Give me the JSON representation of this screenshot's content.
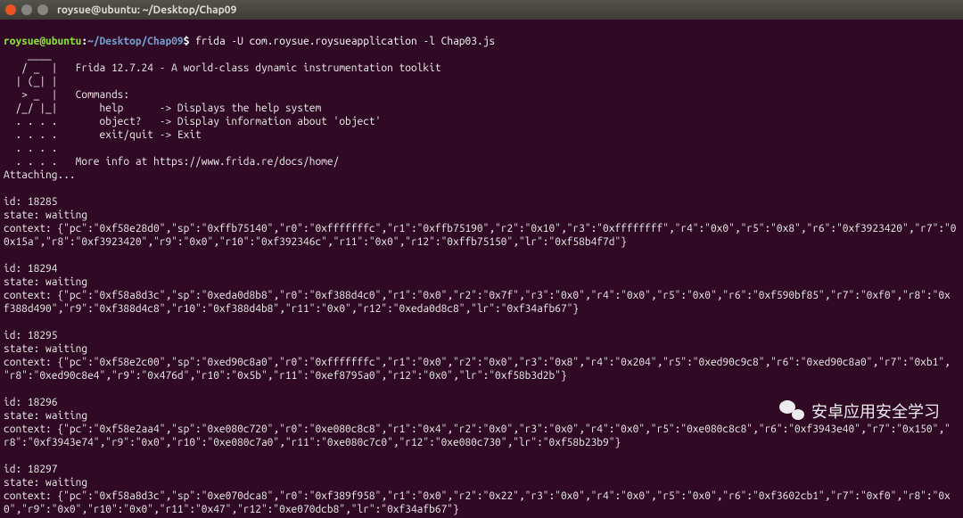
{
  "window": {
    "title": "roysue@ubuntu: ~/Desktop/Chap09"
  },
  "prompt": {
    "userhost": "roysue@ubuntu",
    "sep1": ":",
    "path": "~/Desktop/Chap09",
    "dollar": "$",
    "command": "frida -U com.roysue.roysueapplication -l Chap03.js"
  },
  "frida_banner": {
    "l1": "    ____",
    "l2": "   / _  |   Frida 12.7.24 - A world-class dynamic instrumentation toolkit",
    "l3": "  | (_| |",
    "l4": "   > _  |   Commands:",
    "l5": "  /_/ |_|       help      -> Displays the help system",
    "l6": "  . . . .       object?   -> Display information about 'object'",
    "l7": "  . . . .       exit/quit -> Exit",
    "l8": "  . . . .",
    "l9": "  . . . .   More info at https://www.frida.re/docs/home/",
    "attaching": "Attaching..."
  },
  "threads": [
    {
      "id_line": "id: 18285",
      "state_line": "state: waiting",
      "ctx1": "context: {\"pc\":\"0xf58e28d0\",\"sp\":\"0xffb75140\",\"r0\":\"0xfffffffc\",\"r1\":\"0xffb75190\",\"r2\":\"0x10\",\"r3\":\"0xffffffff\",\"r4\":\"0x0\",\"r5\":\"0x8\",\"r6\":\"0xf3923420\",\"r7\":\"0",
      "ctx2": "0x15a\",\"r8\":\"0xf3923420\",\"r9\":\"0x0\",\"r10\":\"0xf392346c\",\"r11\":\"0x0\",\"r12\":\"0xffb75150\",\"lr\":\"0xf58b4f7d\"}"
    },
    {
      "id_line": "id: 18294",
      "state_line": "state: waiting",
      "ctx1": "context: {\"pc\":\"0xf58a8d3c\",\"sp\":\"0xeda0d8b8\",\"r0\":\"0xf388d4c0\",\"r1\":\"0x0\",\"r2\":\"0x7f\",\"r3\":\"0x0\",\"r4\":\"0x0\",\"r5\":\"0x0\",\"r6\":\"0xf590bf85\",\"r7\":\"0xf0\",\"r8\":\"0x",
      "ctx2": "f388d490\",\"r9\":\"0xf388d4c8\",\"r10\":\"0xf388d4b8\",\"r11\":\"0x0\",\"r12\":\"0xeda0d8c8\",\"lr\":\"0xf34afb67\"}"
    },
    {
      "id_line": "id: 18295",
      "state_line": "state: waiting",
      "ctx1": "context: {\"pc\":\"0xf58e2c00\",\"sp\":\"0xed90c8a0\",\"r0\":\"0xfffffffc\",\"r1\":\"0x0\",\"r2\":\"0x0\",\"r3\":\"0x8\",\"r4\":\"0x204\",\"r5\":\"0xed90c9c8\",\"r6\":\"0xed90c8a0\",\"r7\":\"0xb1\",",
      "ctx2": "\"r8\":\"0xed90c8e4\",\"r9\":\"0x476d\",\"r10\":\"0x5b\",\"r11\":\"0xef8795a0\",\"r12\":\"0x0\",\"lr\":\"0xf58b3d2b\"}"
    },
    {
      "id_line": "id: 18296",
      "state_line": "state: waiting",
      "ctx1": "context: {\"pc\":\"0xf58e2aa4\",\"sp\":\"0xe080c720\",\"r0\":\"0xe080c8c8\",\"r1\":\"0x4\",\"r2\":\"0x0\",\"r3\":\"0x0\",\"r4\":\"0x0\",\"r5\":\"0xe080c8c8\",\"r6\":\"0xf3943e40\",\"r7\":\"0x150\",\"",
      "ctx2": "r8\":\"0xf3943e74\",\"r9\":\"0x0\",\"r10\":\"0xe080c7a0\",\"r11\":\"0xe080c7c0\",\"r12\":\"0xe080c730\",\"lr\":\"0xf58b23b9\"}"
    },
    {
      "id_line": "id: 18297",
      "state_line": "state: waiting",
      "ctx1": "context: {\"pc\":\"0xf58a8d3c\",\"sp\":\"0xe070dca8\",\"r0\":\"0xf389f958\",\"r1\":\"0x0\",\"r2\":\"0x22\",\"r3\":\"0x0\",\"r4\":\"0x0\",\"r5\":\"0x0\",\"r6\":\"0xf3602cb1\",\"r7\":\"0xf0\",\"r8\":\"0x",
      "ctx2": "0\",\"r9\":\"0x0\",\"r10\":\"0x0\",\"r11\":\"0x47\",\"r12\":\"0xe070dcb8\",\"lr\":\"0xf34afb67\"}"
    }
  ],
  "watermark": {
    "text": "安卓应用安全学习"
  }
}
